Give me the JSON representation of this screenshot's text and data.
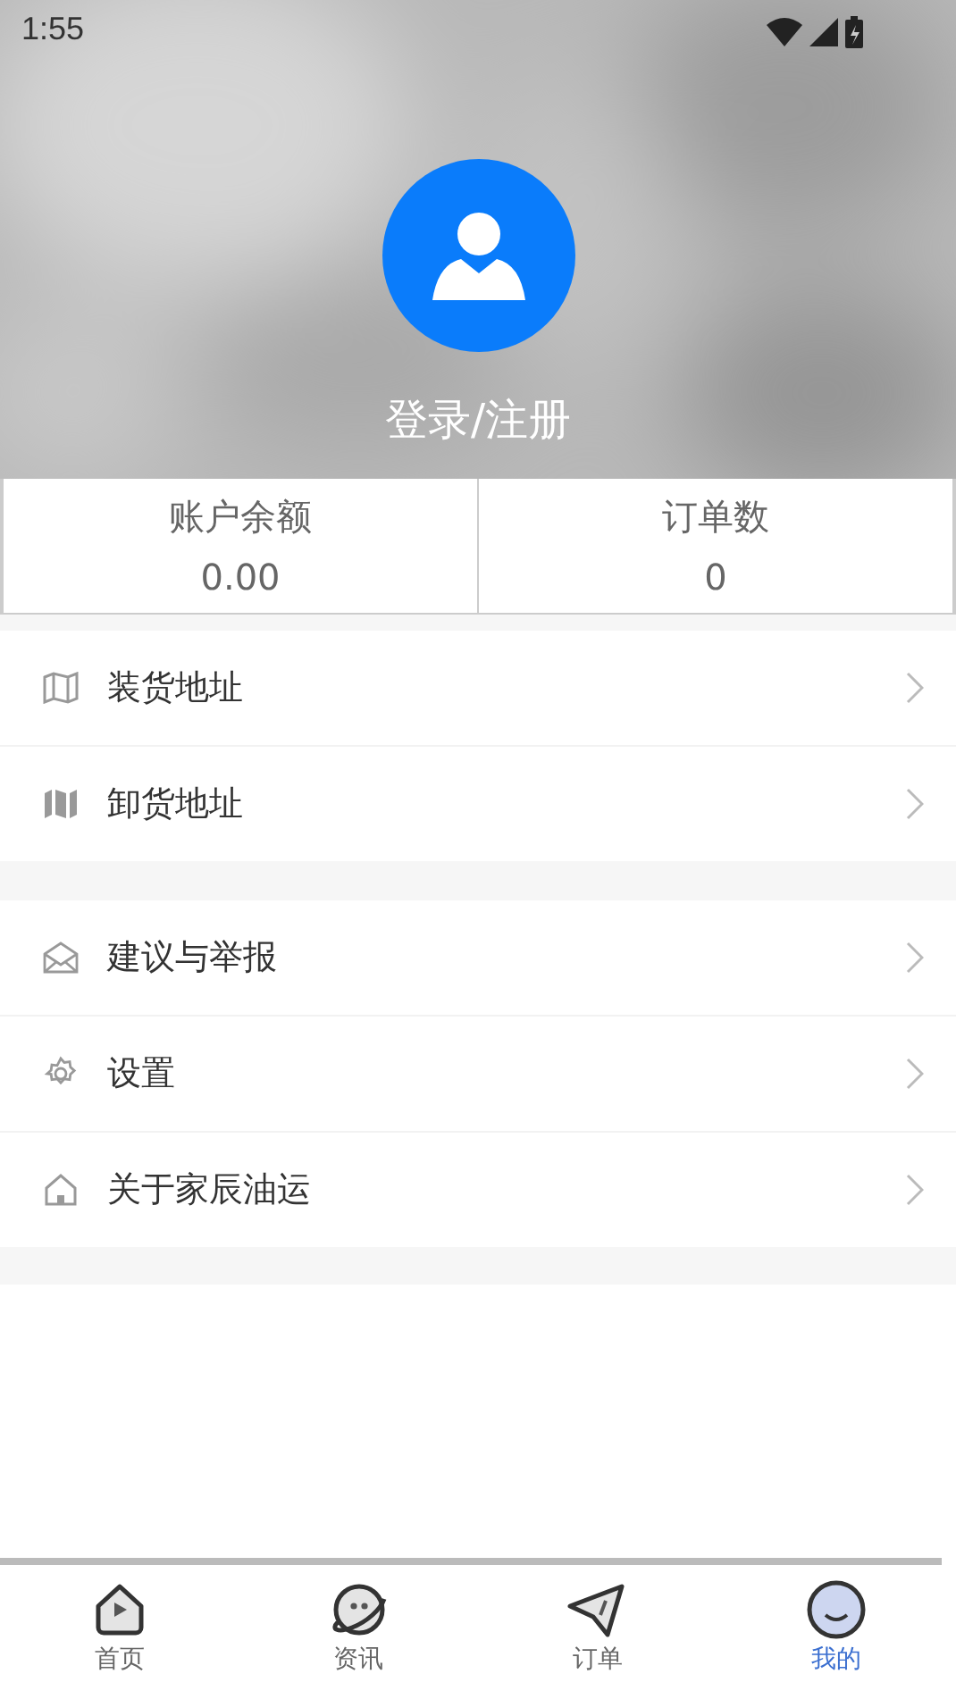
{
  "status_bar": {
    "time": "1:55"
  },
  "profile": {
    "login_label": "登录/注册"
  },
  "stats": [
    {
      "label": "账户余额",
      "value": "0.00"
    },
    {
      "label": "订单数",
      "value": "0"
    }
  ],
  "menu_groups": [
    [
      {
        "label": "装货地址"
      },
      {
        "label": "卸货地址"
      }
    ],
    [
      {
        "label": "建议与举报"
      },
      {
        "label": "设置"
      },
      {
        "label": "关于家辰油运"
      }
    ]
  ],
  "tab_bar": [
    {
      "label": "首页",
      "selected": false
    },
    {
      "label": "资讯",
      "selected": false
    },
    {
      "label": "订单",
      "selected": false
    },
    {
      "label": "我的",
      "selected": true
    }
  ]
}
